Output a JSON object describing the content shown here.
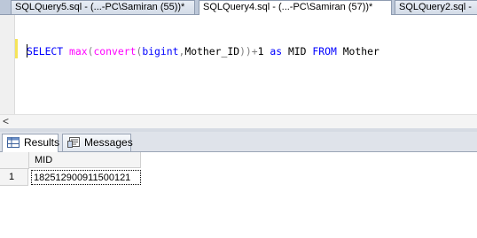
{
  "tabs": [
    {
      "label": "SQLQuery5.sql - (...-PC\\Samiran (55))*",
      "active": false
    },
    {
      "label": "SQLQuery4.sql - (...-PC\\Samiran (57))*",
      "active": true
    },
    {
      "label": "SQLQuery2.sql -",
      "active": false
    }
  ],
  "editor": {
    "tokens": {
      "select": "SELECT",
      "max": "max",
      "paren1": "(",
      "convert": "convert",
      "paren2": "(",
      "bigint": "bigint",
      "comma": ",",
      "column": "Mother_ID",
      "close": "))",
      "plus": "+",
      "one": "1",
      "as": "as",
      "alias": "MID",
      "from": "FROM",
      "table": "Mother"
    }
  },
  "scroll": {
    "left_arrow": "<"
  },
  "results_tabs": {
    "results": "Results",
    "messages": "Messages"
  },
  "grid": {
    "columns": [
      "MID"
    ],
    "rows": [
      {
        "num": "1",
        "values": [
          "182512900911500121"
        ]
      }
    ]
  },
  "colors": {
    "keyword": "#0000ff",
    "function": "#ff00ff",
    "operator": "#808080",
    "change_marker": "#f5e45a"
  }
}
